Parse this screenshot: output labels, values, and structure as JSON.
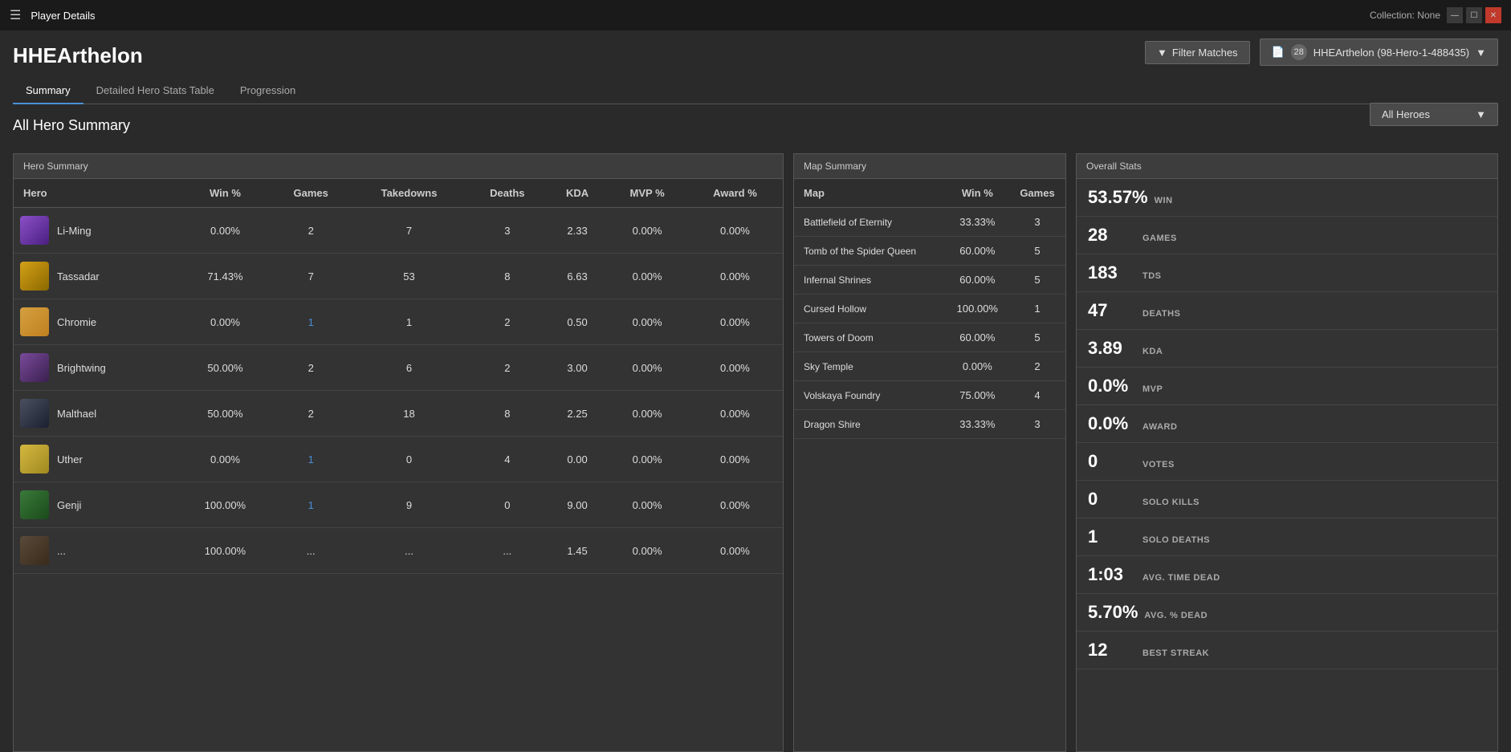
{
  "titleBar": {
    "icon": "☰",
    "title": "Player Details",
    "collection": "Collection: None",
    "windowControls": [
      "—",
      "☐",
      "✕"
    ]
  },
  "playerName": "HHEArthelon",
  "filterBtn": "Filter Matches",
  "collectionLabel": "HHEArthelon (98-Hero-1-488435)",
  "collectionNum": "28",
  "tabs": [
    {
      "label": "Summary",
      "active": true
    },
    {
      "label": "Detailed Hero Stats Table",
      "active": false
    },
    {
      "label": "Progression",
      "active": false
    }
  ],
  "sectionTitle": "All Hero Summary",
  "allHeroesDropdown": "All Heroes",
  "heroSummary": {
    "panelHeader": "Hero Summary",
    "columns": [
      "Hero",
      "Win %",
      "Games",
      "Takedowns",
      "Deaths",
      "KDA",
      "MVP %",
      "Award %"
    ],
    "rows": [
      {
        "name": "Li-Ming",
        "iconClass": "li-ming",
        "winPct": "0.00%",
        "games": "2",
        "takedowns": "7",
        "deaths": "3",
        "kda": "2.33",
        "mvpPct": "0.00%",
        "awardPct": "0.00%",
        "gamesHighlight": false
      },
      {
        "name": "Tassadar",
        "iconClass": "tassadar",
        "winPct": "71.43%",
        "games": "7",
        "takedowns": "53",
        "deaths": "8",
        "kda": "6.63",
        "mvpPct": "0.00%",
        "awardPct": "0.00%",
        "gamesHighlight": false
      },
      {
        "name": "Chromie",
        "iconClass": "chromie",
        "winPct": "0.00%",
        "games": "1",
        "takedowns": "1",
        "deaths": "2",
        "kda": "0.50",
        "mvpPct": "0.00%",
        "awardPct": "0.00%",
        "gamesHighlight": true
      },
      {
        "name": "Brightwing",
        "iconClass": "brightwing",
        "winPct": "50.00%",
        "games": "2",
        "takedowns": "6",
        "deaths": "2",
        "kda": "3.00",
        "mvpPct": "0.00%",
        "awardPct": "0.00%",
        "gamesHighlight": false
      },
      {
        "name": "Malthael",
        "iconClass": "malthael",
        "winPct": "50.00%",
        "games": "2",
        "takedowns": "18",
        "deaths": "8",
        "kda": "2.25",
        "mvpPct": "0.00%",
        "awardPct": "0.00%",
        "gamesHighlight": false
      },
      {
        "name": "Uther",
        "iconClass": "uther",
        "winPct": "0.00%",
        "games": "1",
        "takedowns": "0",
        "deaths": "4",
        "kda": "0.00",
        "mvpPct": "0.00%",
        "awardPct": "0.00%",
        "gamesHighlight": true
      },
      {
        "name": "Genji",
        "iconClass": "genji",
        "winPct": "100.00%",
        "games": "1",
        "takedowns": "9",
        "deaths": "0",
        "kda": "9.00",
        "mvpPct": "0.00%",
        "awardPct": "0.00%",
        "gamesHighlight": true
      },
      {
        "name": "...",
        "iconClass": "partial",
        "winPct": "100.00%",
        "games": "...",
        "takedowns": "...",
        "deaths": "...",
        "kda": "1.45",
        "mvpPct": "0.00%",
        "awardPct": "0.00%",
        "gamesHighlight": false
      }
    ]
  },
  "mapSummary": {
    "panelHeader": "Map Summary",
    "columns": [
      "Map",
      "Win %",
      "Games"
    ],
    "rows": [
      {
        "name": "Battlefield of Eternity",
        "winPct": "33.33%",
        "games": "3"
      },
      {
        "name": "Tomb of the Spider Queen",
        "winPct": "60.00%",
        "games": "5"
      },
      {
        "name": "Infernal Shrines",
        "winPct": "60.00%",
        "games": "5"
      },
      {
        "name": "Cursed Hollow",
        "winPct": "100.00%",
        "games": "1"
      },
      {
        "name": "Towers of Doom",
        "winPct": "60.00%",
        "games": "5"
      },
      {
        "name": "Sky Temple",
        "winPct": "0.00%",
        "games": "2"
      },
      {
        "name": "Volskaya Foundry",
        "winPct": "75.00%",
        "games": "4"
      },
      {
        "name": "Dragon Shire",
        "winPct": "33.33%",
        "games": "3"
      }
    ]
  },
  "overallStats": {
    "panelHeader": "Overall Stats",
    "stats": [
      {
        "value": "53.57%",
        "label": "WIN"
      },
      {
        "value": "28",
        "label": "GAMES"
      },
      {
        "value": "183",
        "label": "TDS"
      },
      {
        "value": "47",
        "label": "DEATHS"
      },
      {
        "value": "3.89",
        "label": "KDA"
      },
      {
        "value": "0.0%",
        "label": "MVP"
      },
      {
        "value": "0.0%",
        "label": "AWARD"
      },
      {
        "value": "0",
        "label": "VOTES"
      },
      {
        "value": "0",
        "label": "SOLO KILLS"
      },
      {
        "value": "1",
        "label": "SOLO DEATHS"
      },
      {
        "value": "1:03",
        "label": "AVG. TIME DEAD"
      },
      {
        "value": "5.70%",
        "label": "AVG. % DEAD"
      },
      {
        "value": "12",
        "label": "BEST STREAK"
      }
    ]
  }
}
